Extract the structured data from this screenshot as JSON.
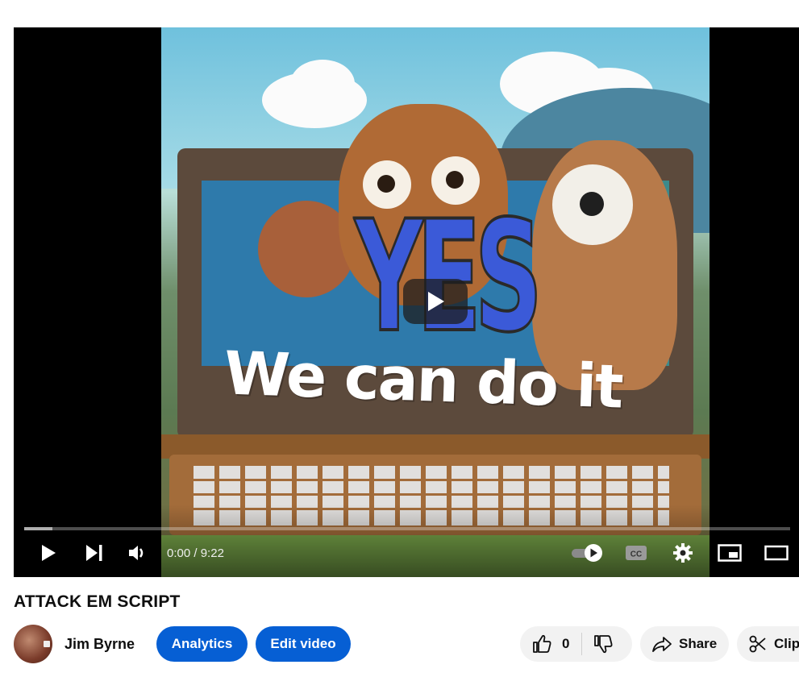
{
  "player": {
    "overlay_word": "YES",
    "overlay_caption": "We can do it",
    "time_current": "0:00",
    "time_separator": " / ",
    "time_total": "9:22",
    "progress_loaded_fraction": 0.037,
    "progress_played_fraction": 0.0,
    "autoplay_on": true,
    "controls": {
      "play": "play-icon",
      "next": "skip-next-icon",
      "volume": "volume-icon",
      "autoplay": "autoplay-toggle-icon",
      "captions": "cc-icon",
      "settings": "gear-icon",
      "miniplayer": "miniplayer-icon",
      "theater": "theater-mode-icon"
    }
  },
  "video": {
    "title": "ATTACK EM SCRIPT"
  },
  "channel": {
    "name": "Jim Byrne"
  },
  "actions": {
    "analytics_label": "Analytics",
    "edit_label": "Edit video",
    "like_count": "0",
    "share_label": "Share",
    "clip_label": "Clip"
  },
  "colors": {
    "brand_blue": "#065fd4",
    "button_grey": "#f2f2f2",
    "player_bg": "#000000"
  }
}
